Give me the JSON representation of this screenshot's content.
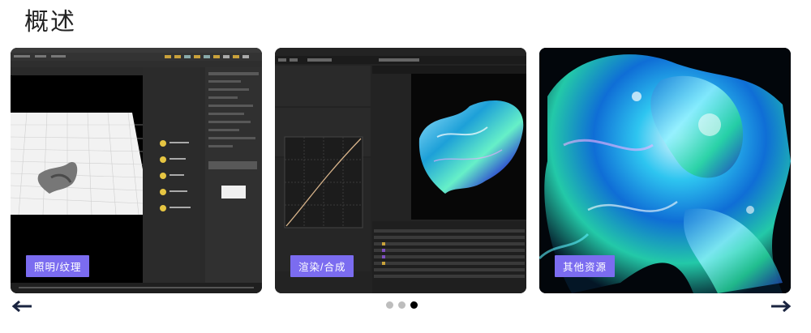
{
  "section": {
    "title": "概述"
  },
  "carousel": {
    "slides": [
      {
        "label": "照明/纹理",
        "icon": "houdini-screenshot"
      },
      {
        "label": "渲染/合成",
        "icon": "after-effects-screenshot"
      },
      {
        "label": "其他资源",
        "icon": "iridescent-blob-render"
      }
    ],
    "active_index": 2,
    "prev_icon": "arrow-left-icon",
    "next_icon": "arrow-right-icon"
  },
  "colors": {
    "label_bg": "#7b6cf0",
    "editor_bg": "#262626",
    "dot_active": "#000000",
    "dot_inactive": "#bdbdbd"
  }
}
